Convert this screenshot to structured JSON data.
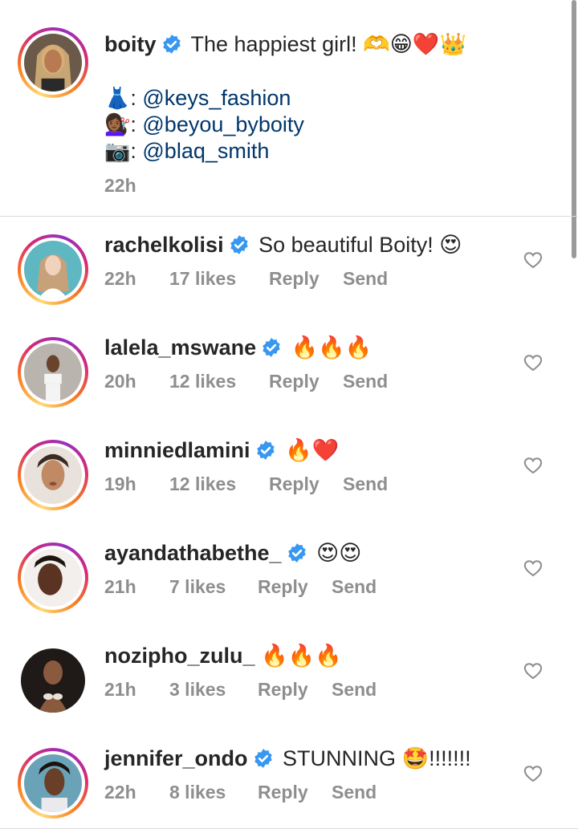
{
  "caption": {
    "username": "boity",
    "text": "The happiest girl! 🫶😁❤️👑",
    "credits": [
      {
        "emoji": "👗",
        "sep": ": ",
        "handle": "@keys_fashion"
      },
      {
        "emoji": "💇🏾‍♀️",
        "sep": ": ",
        "handle": "@beyou_byboity"
      },
      {
        "emoji": "📷",
        "sep": ": ",
        "handle": "@blaq_smith"
      }
    ],
    "time": "22h"
  },
  "actions": {
    "reply": "Reply",
    "send": "Send"
  },
  "comments": [
    {
      "username": "rachelkolisi",
      "verified": true,
      "text": "So beautiful Boity! 😍",
      "time": "22h",
      "likes": "17 likes",
      "avatar_bg": "#5fb7c2"
    },
    {
      "username": "lalela_mswane",
      "verified": true,
      "text": "🔥🔥🔥",
      "time": "20h",
      "likes": "12 likes",
      "avatar_bg": "#b9b4ad"
    },
    {
      "username": "minniedlamini",
      "verified": true,
      "text": "🔥❤️",
      "time": "19h",
      "likes": "12 likes",
      "avatar_bg": "#e9e2dc"
    },
    {
      "username": "ayandathabethe_",
      "verified": true,
      "text": "😍😍",
      "time": "21h",
      "likes": "7 likes",
      "avatar_bg": "#f2efec"
    },
    {
      "username": "nozipho_zulu_",
      "verified": false,
      "text": "🔥🔥🔥",
      "time": "21h",
      "likes": "3 likes",
      "avatar_bg": "#1f1a17"
    },
    {
      "username": "jennifer_ondo",
      "verified": true,
      "text": "STUNNING 🤩!!!!!!!",
      "time": "22h",
      "likes": "8 likes",
      "avatar_bg": "#6aa3b8"
    }
  ],
  "colors": {
    "verified": "#3897f0",
    "mention": "#00376b",
    "meta": "#8e8e8e"
  }
}
